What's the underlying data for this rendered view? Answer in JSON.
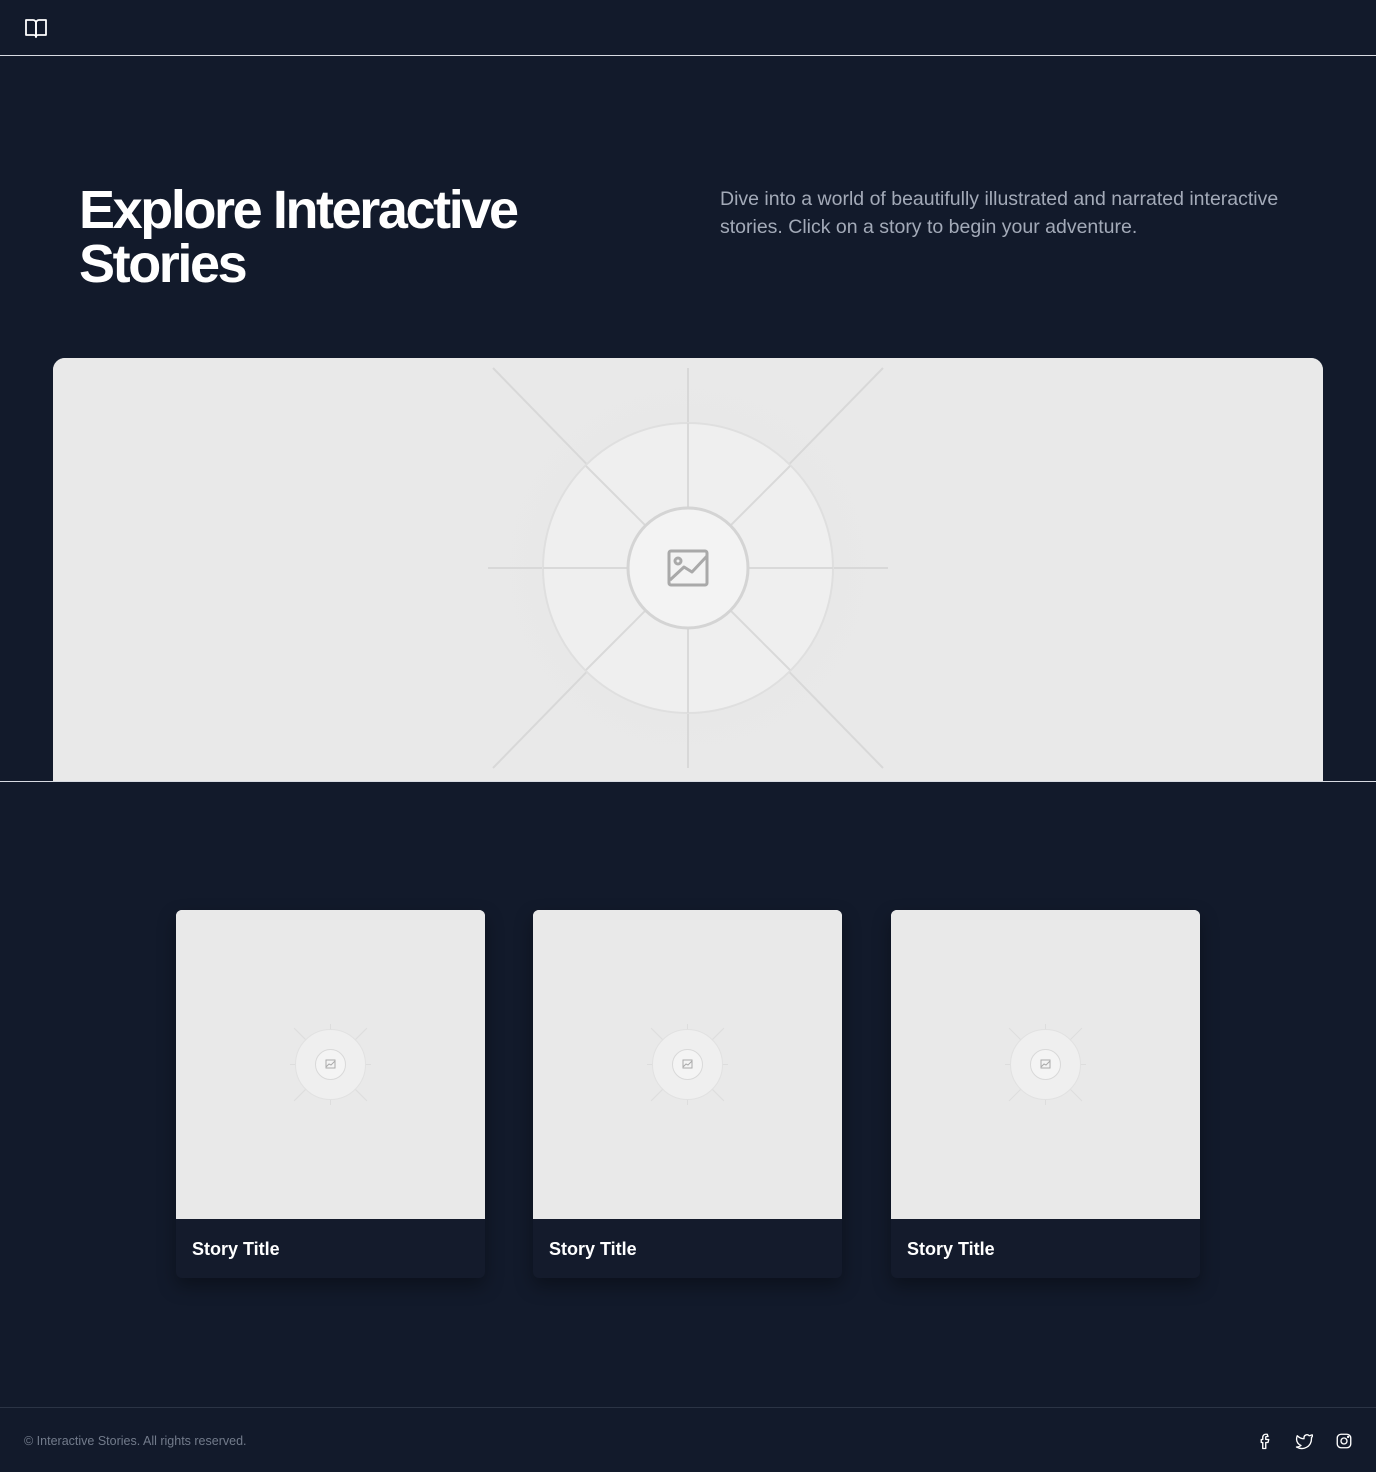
{
  "header": {
    "logo_icon": "open-book-icon"
  },
  "hero": {
    "title": "Explore Interactive Stories",
    "description": "Dive into a world of beautifully illustrated and narrated interactive stories. Click on a story to begin your adventure.",
    "image_icon": "image-placeholder-icon"
  },
  "stories": [
    {
      "title": "Story Title",
      "image_icon": "image-placeholder-icon"
    },
    {
      "title": "Story Title",
      "image_icon": "image-placeholder-icon"
    },
    {
      "title": "Story Title",
      "image_icon": "image-placeholder-icon"
    }
  ],
  "footer": {
    "copyright": "© Interactive Stories. All rights reserved.",
    "social_icons": [
      "facebook-icon",
      "twitter-icon",
      "instagram-icon"
    ]
  },
  "colors": {
    "background": "#121a2b",
    "text_primary": "#ffffff",
    "text_secondary": "#a3aab8",
    "placeholder": "#e9e9e9"
  }
}
